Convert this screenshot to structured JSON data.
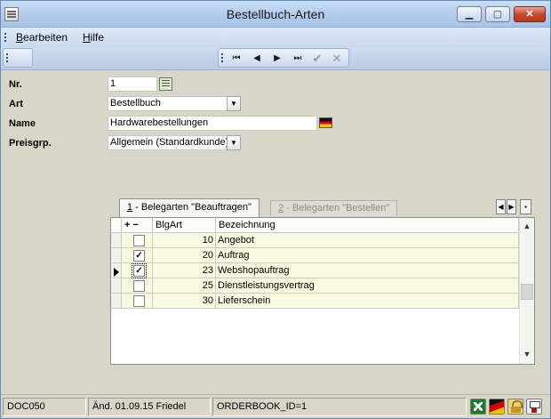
{
  "window": {
    "title": "Bestellbuch-Arten",
    "controls": {
      "minimize": "▁",
      "maximize": "▢",
      "close": "✕"
    }
  },
  "menu": {
    "items": [
      {
        "label": "Bearbeiten",
        "accel": "B",
        "rest": "earbeiten"
      },
      {
        "label": "Hilfe",
        "accel": "H",
        "rest": "ilfe"
      }
    ]
  },
  "toolbar": {
    "nav": {
      "first": "⏮",
      "prev": "◀",
      "next": "▶",
      "last": "⏭",
      "confirm": "✔",
      "cancel": "✕"
    }
  },
  "form": {
    "nr": {
      "label": "Nr.",
      "value": "1"
    },
    "art": {
      "label": "Art",
      "value": "Bestellbuch"
    },
    "name": {
      "label": "Name",
      "value": "Hardwarebestellungen"
    },
    "preisgrp": {
      "label": "Preisgrp.",
      "value": "Allgemein (Standardkunde)"
    }
  },
  "tabs": [
    {
      "accel": "1",
      "rest": " - Belegarten \"Beauftragen\"",
      "active": true
    },
    {
      "accel": "2",
      "rest": " - Belegarten \"Bestellen\"",
      "active": false
    }
  ],
  "grid": {
    "columns": {
      "plus": "+",
      "minus": "−",
      "blgart": "BlgArt",
      "bezeichnung": "Bezeichnung"
    },
    "rows": [
      {
        "checked": false,
        "blgart": "10",
        "bezeichnung": "Angebot",
        "current": false
      },
      {
        "checked": true,
        "blgart": "20",
        "bezeichnung": "Auftrag",
        "current": false
      },
      {
        "checked": true,
        "blgart": "23",
        "bezeichnung": "Webshopauftrag",
        "current": true
      },
      {
        "checked": false,
        "blgart": "25",
        "bezeichnung": "Dienstleistungsvertrag",
        "current": false
      },
      {
        "checked": false,
        "blgart": "30",
        "bezeichnung": "Lieferschein",
        "current": false
      }
    ]
  },
  "status": {
    "doc": "DOC050",
    "changed": "Änd. 01.09.15 Friedel",
    "key": "ORDERBOOK_ID=1"
  }
}
